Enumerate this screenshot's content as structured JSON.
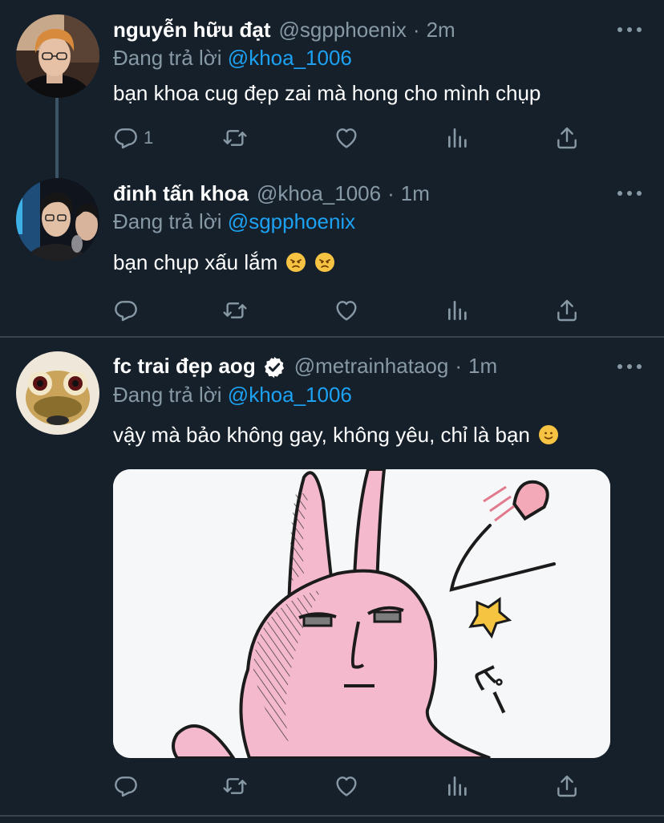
{
  "tweets": [
    {
      "name": "nguyễn hữu đạt",
      "handle": "@sgpphoenix",
      "dot": "·",
      "time": "2m",
      "reply_prefix": "Đang trả lời",
      "reply_mention": "@khoa_1006",
      "text": "bạn khoa cug đẹp zai mà hong cho mình chụp",
      "reply_count": "1"
    },
    {
      "name": "đinh tấn khoa",
      "handle": "@khoa_1006",
      "dot": "·",
      "time": "1m",
      "reply_prefix": "Đang trả lời",
      "reply_mention": "@sgpphoenix",
      "text": "bạn chụp xấu lắm",
      "emojis": [
        "angry-face",
        "angry-face"
      ]
    },
    {
      "name": "fc trai đẹp aog",
      "verified": true,
      "handle": "@metrainhataog",
      "dot": "·",
      "time": "1m",
      "reply_prefix": "Đang trả lời",
      "reply_mention": "@khoa_1006",
      "text": "vậy mà bảo không gay, không yêu, chỉ là bạn",
      "emojis": [
        "slightly-smiling-face"
      ],
      "media": {
        "type": "sticker-image",
        "description_icon": "pink-rabbit-sticker",
        "sticker_text": "ピー"
      }
    }
  ],
  "icons": {
    "reply": "reply-icon",
    "retweet": "retweet-icon",
    "like": "heart-icon",
    "analytics": "analytics-icon",
    "share": "share-icon",
    "more": "more-icon"
  },
  "colors": {
    "background": "#15202b",
    "secondary_text": "#8899a6",
    "accent": "#1da1f2",
    "divider": "#38444d",
    "thread_line": "#3d5466"
  }
}
